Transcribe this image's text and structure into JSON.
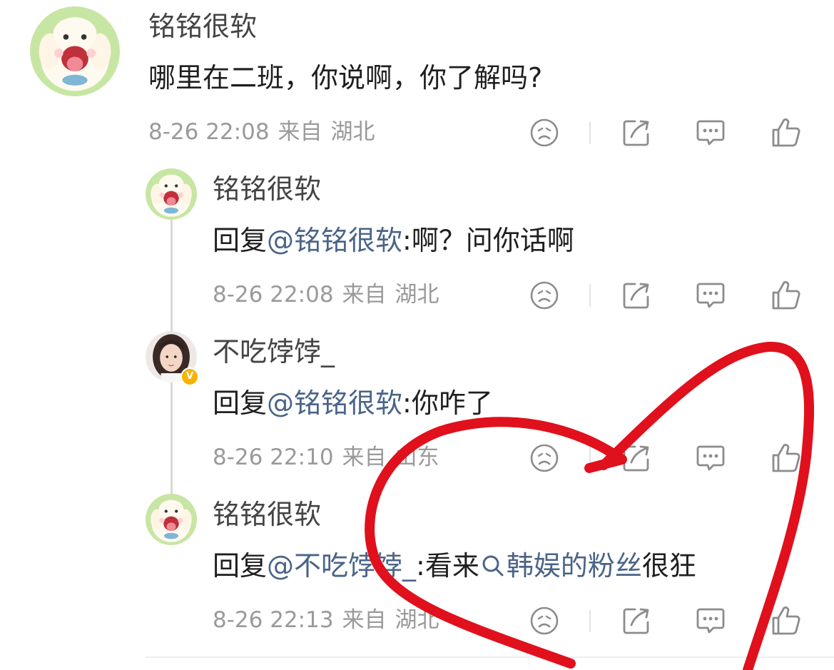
{
  "colors": {
    "mention": "#4a6487",
    "meta": "#9a9a9a",
    "heart": "#e0101c"
  },
  "comments": [
    {
      "author": "铭铭很软",
      "text": "哪里在二班，你说啊，你了解吗?",
      "date": "8-26 22:08",
      "source_label": "来自",
      "location": "湖北",
      "avatar": "cartoon-dog-avatar"
    },
    {
      "author": "铭铭很软",
      "reply_prefix": "回复",
      "mention": "@铭铭很软",
      "text": ":啊？问你话啊",
      "date": "8-26 22:08",
      "source_label": "来自",
      "location": "湖北",
      "avatar": "cartoon-dog-avatar"
    },
    {
      "author": "不吃饽饽_",
      "reply_prefix": "回复",
      "mention": "@铭铭很软",
      "text": ":你咋了",
      "date": "8-26 22:10",
      "source_label": "来自",
      "location": "山东",
      "avatar": "girl-photo-avatar",
      "verified": true
    },
    {
      "author": "铭铭很软",
      "reply_prefix": "回复",
      "mention": "@不吃饽饽_",
      "text": ":看来",
      "topic": "韩娱的粉丝",
      "text_after": "很狂",
      "date": "8-26 22:13",
      "source_label": "来自",
      "location": "湖北",
      "avatar": "cartoon-dog-avatar"
    }
  ],
  "icons": [
    "sad-face-icon",
    "share-icon",
    "comment-icon",
    "like-icon"
  ]
}
